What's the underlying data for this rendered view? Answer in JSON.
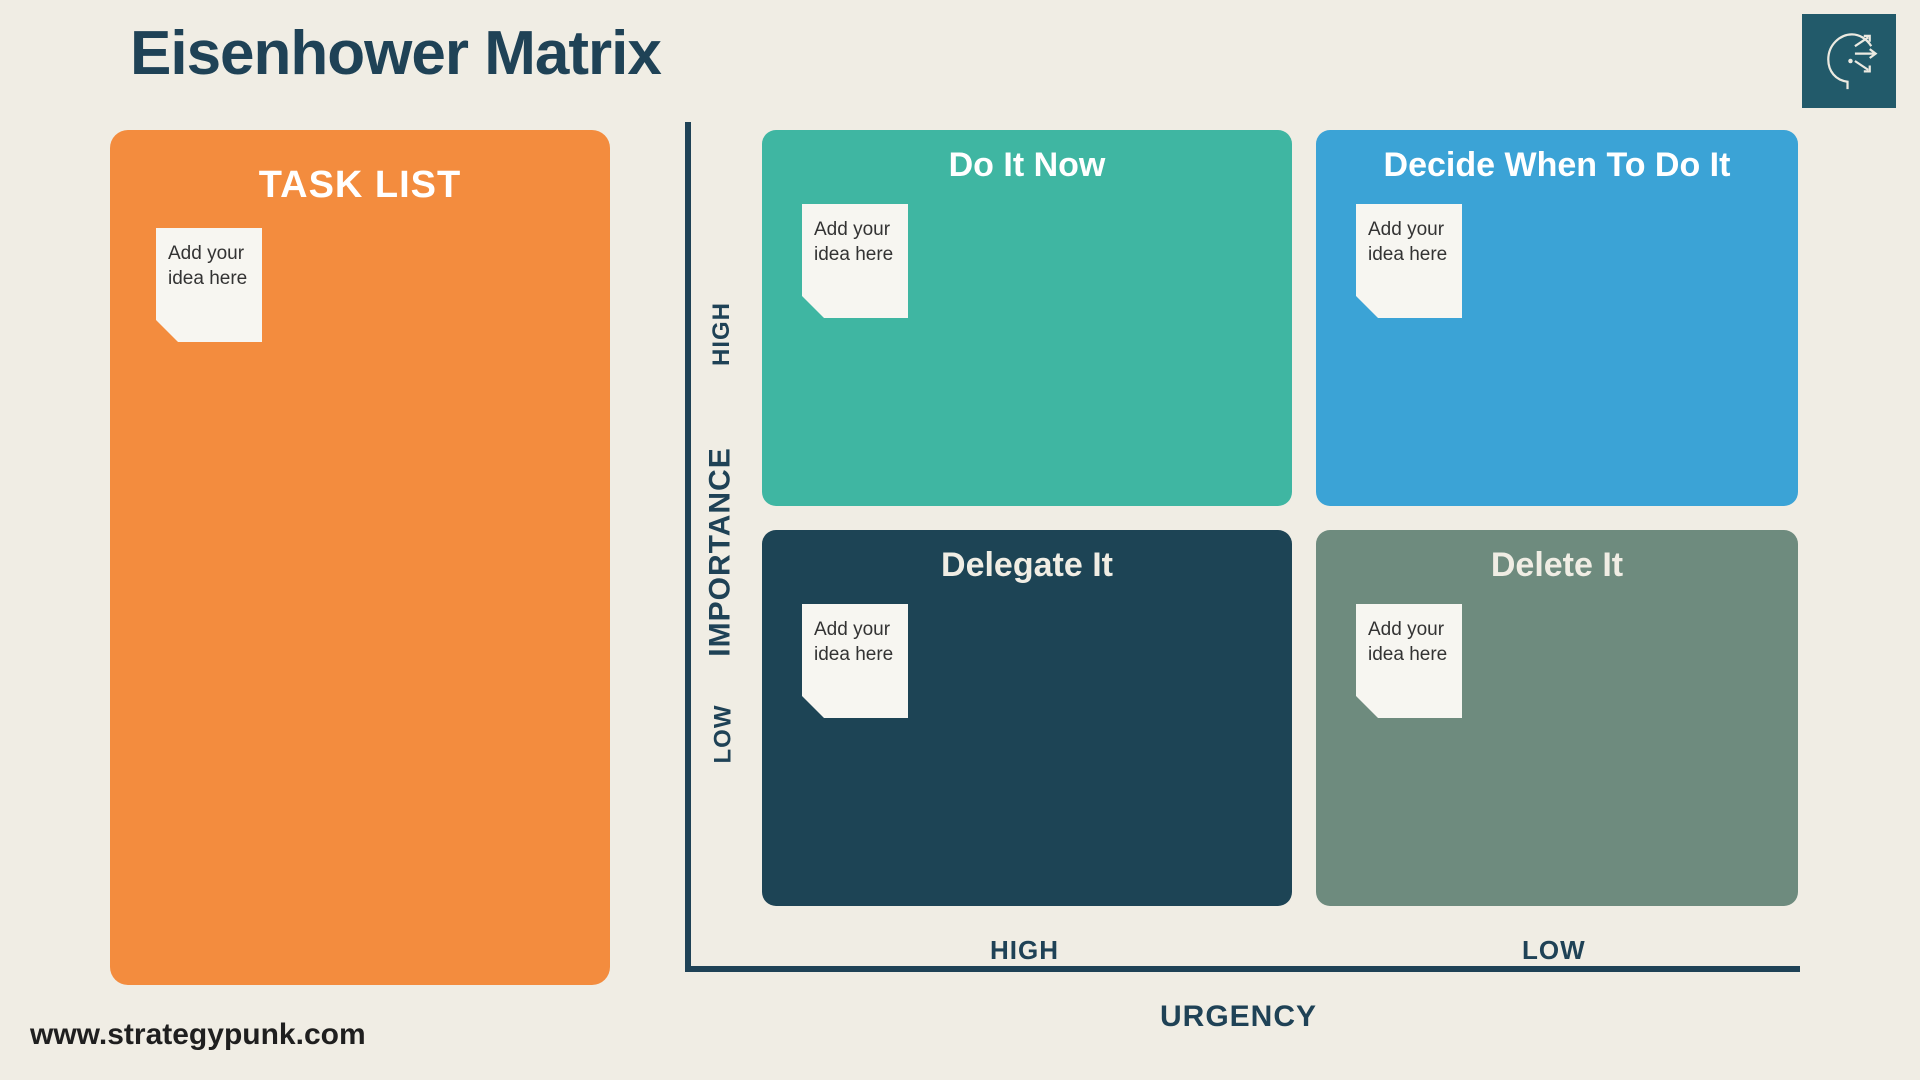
{
  "title": "Eisenhower Matrix",
  "footer_url": "www.strategypunk.com",
  "tasklist": {
    "title": "TASK LIST",
    "sticky_text": "Add your idea here"
  },
  "axes": {
    "importance_label": "IMPORTANCE",
    "urgency_label": "URGENCY",
    "high_y": "HIGH",
    "low_y": "LOW",
    "high_x": "HIGH",
    "low_x": "LOW"
  },
  "quadrants": {
    "q1": {
      "title": "Do It Now",
      "sticky_text": "Add your idea here",
      "color": "#3fb6a2"
    },
    "q2": {
      "title": "Decide When To Do It",
      "sticky_text": "Add your idea here",
      "color": "#3ba3d6"
    },
    "q3": {
      "title": "Delegate It",
      "sticky_text": "Add your idea here",
      "color": "#1d4455"
    },
    "q4": {
      "title": "Delete It",
      "sticky_text": "Add your idea here",
      "color": "#6e8b7e"
    }
  }
}
